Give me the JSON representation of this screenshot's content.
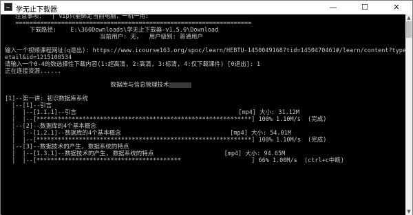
{
  "window": {
    "title": "学无止下载器",
    "icon": "console-icon",
    "controls": {
      "minimize": "—",
      "maximize": "☐",
      "close": "✕"
    }
  },
  "console": {
    "lines": [
      "   注意事项：  | Vip只能绑定当前电脑，一机一用！",
      "   ===================================================================",
      "       下载路径:    E:\\360Downloads\\学无止下载器-v1.5.0\\Download",
      "                           当前用户: 无，  用户级别: 普通用户",
      "",
      "输入一个视频课程网址(q退出): https://www.icourse163.org/spoc/learn/HEBTU-1450049168?tid=1450470461#/learn/content?type=d",
      "etail&id=1215108534",
      "请输入一个0-4的数选择性下载内容(1:超高清, 2:高清, 3:标清, 4:仅下载课件) [0退出]: 1",
      "正在连接资源......",
      "",
      "                              数据库与信息管理技术",
      "",
      "[1]--第一讲: 初识数据库系统",
      "  |--[1]--引言",
      "  |  |--[1.1.1]--引言                                              [mp4] 大小: 31.12M",
      "  |  |--[*************************************************************] 100% 1.10M/s  (完成)",
      "  |--[2]--数据库的4个基本概念",
      "  |  |--[1.2.1]--数据库的4个基本概念                               [mp4] 大小: 54.01M",
      "  |  |--[*************************************************************] 100% 1.10M/s  (完成)",
      "  |--[3]--数据技术的产生, 数据系统的特点",
      "  |  |--[1.3.1]--数据技术的产生, 数据系统的特点                    [mp4] 大小: 94.65M",
      "  |  |--[*****************************************                    ] 66% 1.00M/s  (ctrl+c中断)"
    ]
  }
}
